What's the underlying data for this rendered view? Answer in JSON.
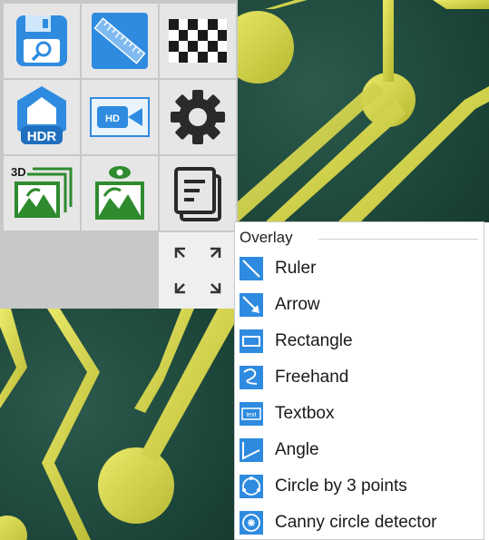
{
  "toolbar": {
    "buttons": [
      {
        "name": "save-snapshot",
        "icon": "save-disk-magnifier-icon"
      },
      {
        "name": "ruler",
        "icon": "ruler-icon"
      },
      {
        "name": "checkerboard",
        "icon": "checkerboard-icon"
      },
      {
        "name": "hdr",
        "icon": "hdr-icon",
        "text": "HDR"
      },
      {
        "name": "hd-video",
        "icon": "hd-camera-icon",
        "text": "HD"
      },
      {
        "name": "settings",
        "icon": "gear-icon"
      },
      {
        "name": "3d-image",
        "icon": "3d-image-icon",
        "text": "3D"
      },
      {
        "name": "image-view",
        "icon": "eye-image-icon"
      },
      {
        "name": "document",
        "icon": "document-icon"
      }
    ],
    "expand_icon": "expand-arrows-icon"
  },
  "overlay": {
    "title": "Overlay",
    "items": [
      {
        "label": "Ruler",
        "icon": "ruler-line-icon"
      },
      {
        "label": "Arrow",
        "icon": "arrow-icon"
      },
      {
        "label": "Rectangle",
        "icon": "rectangle-icon"
      },
      {
        "label": "Freehand",
        "icon": "freehand-icon"
      },
      {
        "label": "Textbox",
        "icon": "textbox-icon",
        "icon_text": "text"
      },
      {
        "label": "Angle",
        "icon": "angle-icon"
      },
      {
        "label": "Circle by 3 points",
        "icon": "circle-3-points-icon"
      },
      {
        "label": "Canny circle detector",
        "icon": "canny-circle-icon"
      }
    ]
  },
  "colors": {
    "accent_blue": "#2f8be0",
    "icon_green": "#2e8b2e",
    "pcb_green": "#1f4a3d",
    "trace_yellow": "#d7d94a"
  }
}
